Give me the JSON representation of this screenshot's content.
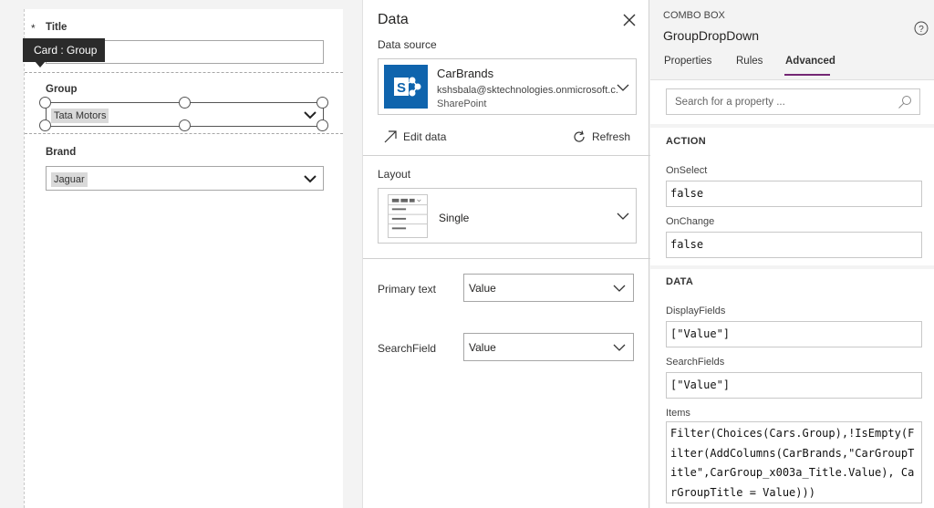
{
  "canvas": {
    "tooltip": "Card : Group",
    "required_marker": "*",
    "title_label": "Title",
    "group_label": "Group",
    "group_value": "Tata Motors",
    "brand_label": "Brand",
    "brand_value": "Jaguar"
  },
  "data_pane": {
    "title": "Data",
    "data_source_label": "Data source",
    "source": {
      "name": "CarBrands",
      "account": "kshsbala@sktechnologies.onmicrosoft.c...",
      "type": "SharePoint",
      "logo_icon": "sharepoint-icon",
      "brand_color": "#0f64ad"
    },
    "edit_data": "Edit data",
    "refresh": "Refresh",
    "layout_label": "Layout",
    "layout_value": "Single",
    "primary_text_label": "Primary text",
    "primary_text_value": "Value",
    "search_field_label": "SearchField",
    "search_field_value": "Value"
  },
  "props_pane": {
    "kind": "COMBO BOX",
    "control_name": "GroupDropDown",
    "tabs": [
      {
        "label": "Properties",
        "active": false
      },
      {
        "label": "Rules",
        "active": false
      },
      {
        "label": "Advanced",
        "active": true
      }
    ],
    "accent_color": "#742774",
    "search_placeholder": "Search for a property ...",
    "action_section": "ACTION",
    "on_select_label": "OnSelect",
    "on_select_value": "false",
    "on_change_label": "OnChange",
    "on_change_value": "false",
    "data_section": "DATA",
    "display_fields_label": "DisplayFields",
    "display_fields_value": "[\"Value\"]",
    "search_fields_label": "SearchFields",
    "search_fields_value": "[\"Value\"]",
    "items_label": "Items",
    "items_value": "Filter(Choices(Cars.Group),!IsEmpty(Filter(AddColumns(CarBrands,\"CarGroupTitle\",CarGroup_x003a_Title.Value), CarGroupTitle = Value)))"
  }
}
